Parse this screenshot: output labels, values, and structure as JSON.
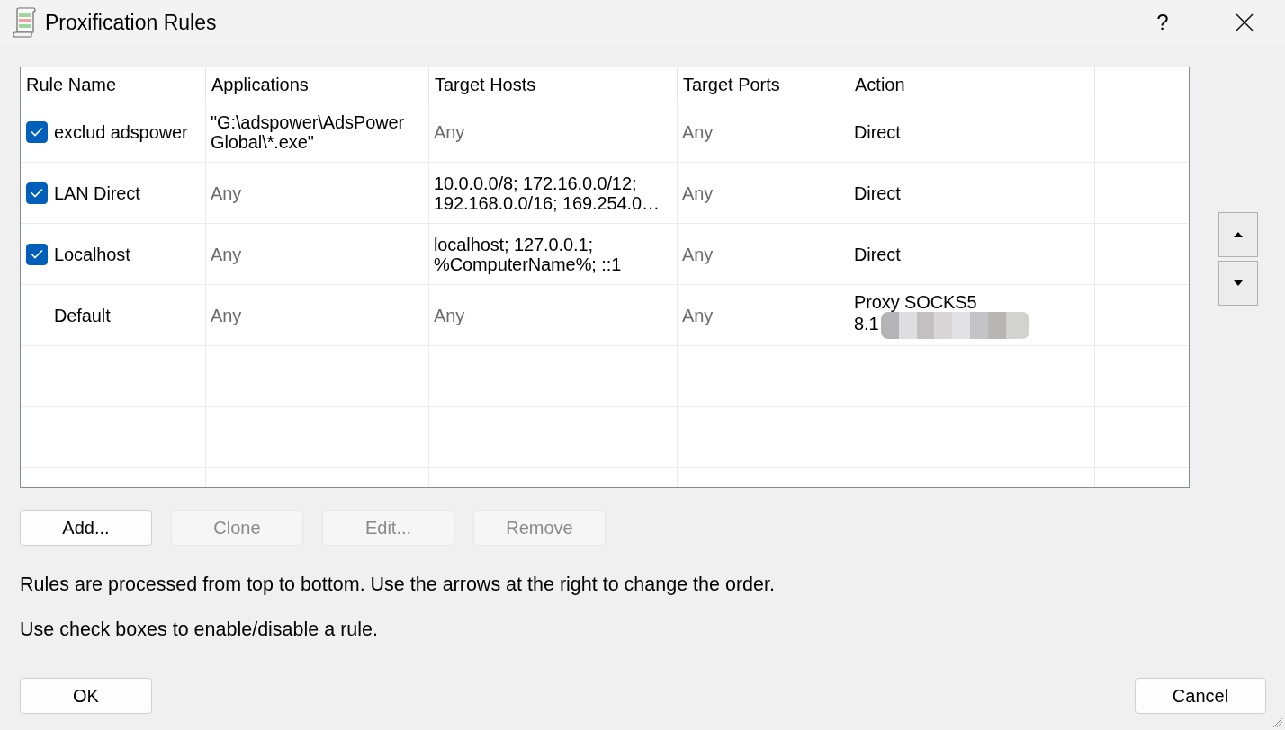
{
  "window": {
    "title": "Proxification Rules",
    "help_button": "?"
  },
  "table": {
    "columns": [
      "Rule Name",
      "Applications",
      "Target Hosts",
      "Target Ports",
      "Action"
    ],
    "rows": [
      {
        "kind": "rule",
        "checked": true,
        "name": "exclud adspower",
        "applications": {
          "text": "\"G:\\adspower\\AdsPower Global\\*.exe\"",
          "any": false
        },
        "target_hosts": {
          "text": "Any",
          "any": true
        },
        "target_ports": {
          "text": "Any",
          "any": true
        },
        "action": {
          "text": "Direct"
        }
      },
      {
        "kind": "rule",
        "checked": true,
        "name": "LAN Direct",
        "applications": {
          "text": "Any",
          "any": true
        },
        "target_hosts": {
          "text": "10.0.0.0/8; 172.16.0.0/12; 192.168.0.0/16; 169.254.0…",
          "any": false
        },
        "target_ports": {
          "text": "Any",
          "any": true
        },
        "action": {
          "text": "Direct"
        }
      },
      {
        "kind": "rule",
        "checked": true,
        "name": "Localhost",
        "applications": {
          "text": "Any",
          "any": true
        },
        "target_hosts": {
          "text": "localhost; 127.0.0.1; %ComputerName%; ::1",
          "any": false
        },
        "target_ports": {
          "text": "Any",
          "any": true
        },
        "action": {
          "text": "Direct"
        }
      },
      {
        "kind": "default",
        "name": "Default",
        "applications": {
          "text": "Any",
          "any": true
        },
        "target_hosts": {
          "text": "Any",
          "any": true
        },
        "target_ports": {
          "text": "Any",
          "any": true
        },
        "action": {
          "text": "Proxy SOCKS5\n8.1",
          "redacted": true
        }
      }
    ]
  },
  "rule_buttons": [
    {
      "label": "Add...",
      "disabled": false
    },
    {
      "label": "Clone",
      "disabled": true
    },
    {
      "label": "Edit...",
      "disabled": true
    },
    {
      "label": "Remove",
      "disabled": true
    }
  ],
  "notes": [
    "Rules are processed from top to bottom. Use the arrows at the right to change the order.",
    "Use check boxes to enable/disable a rule."
  ],
  "dialog_buttons": [
    "OK",
    "Cancel"
  ]
}
